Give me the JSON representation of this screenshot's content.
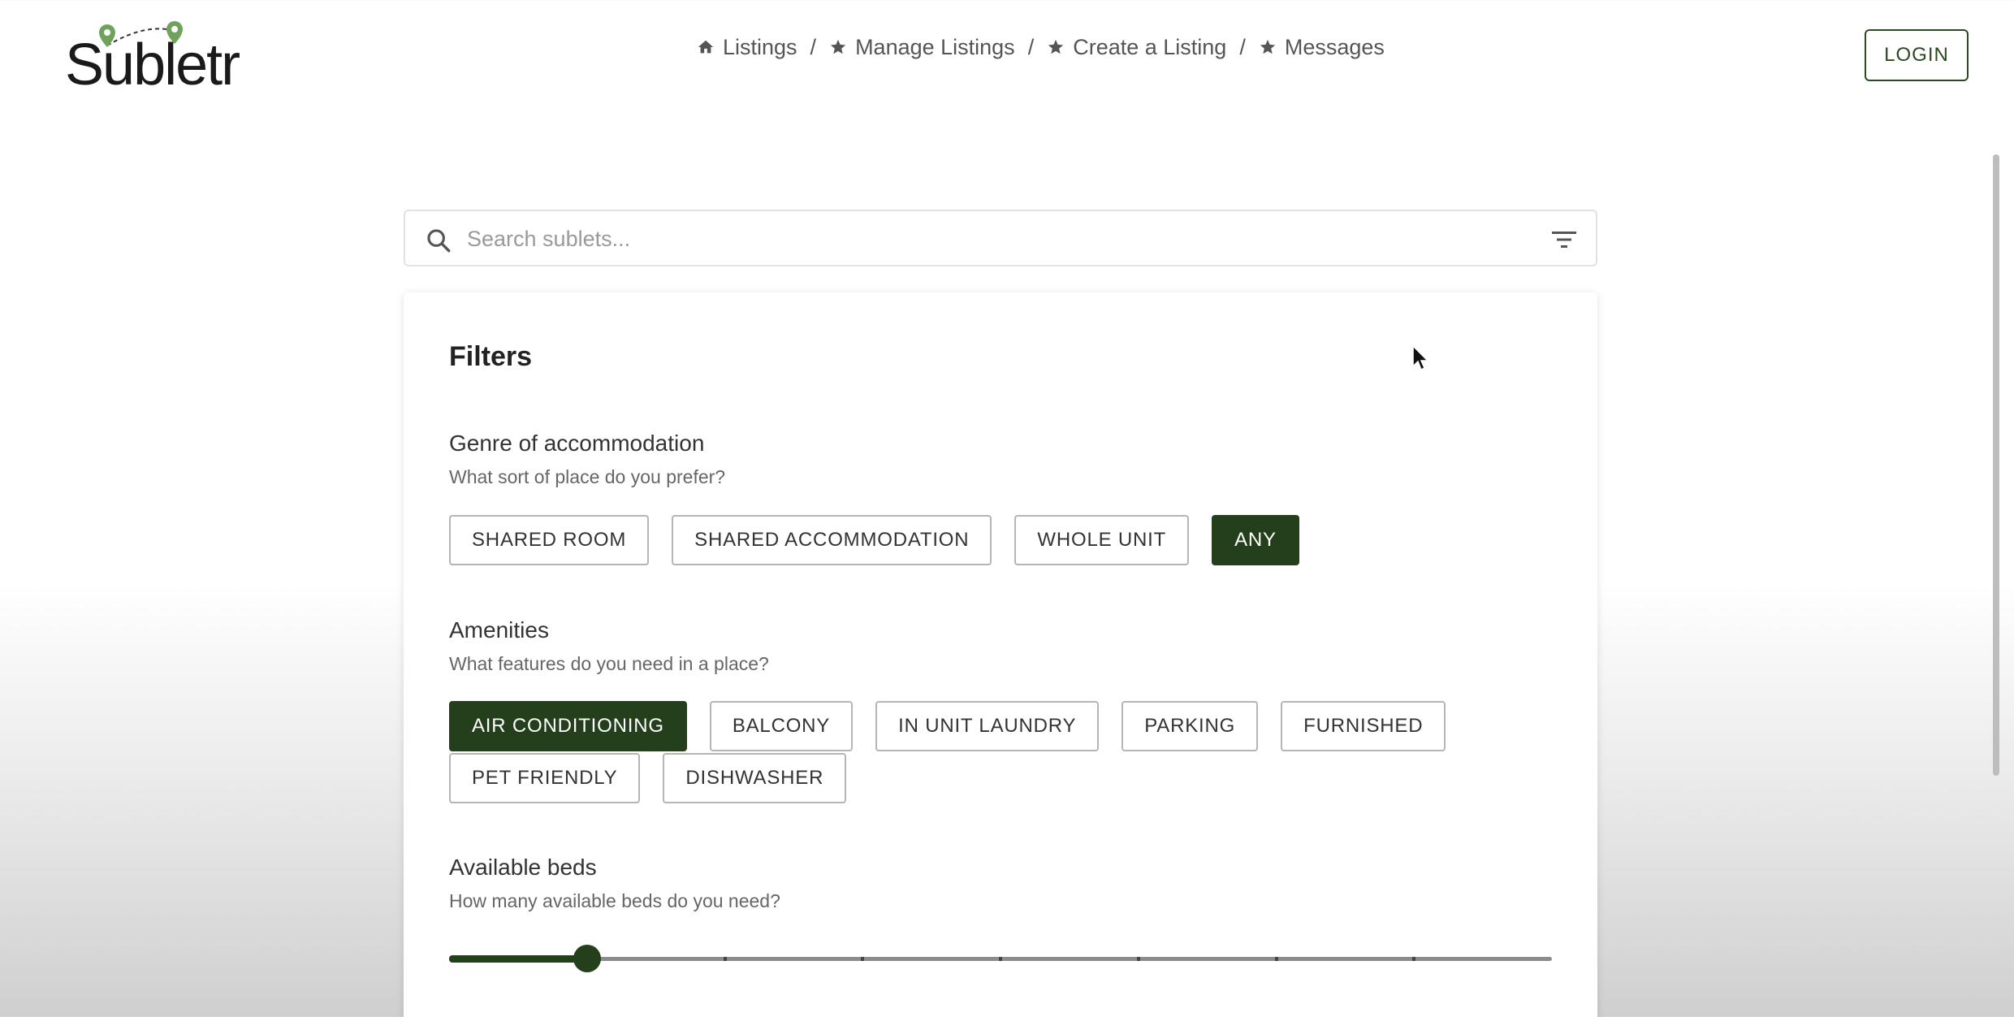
{
  "app": {
    "logo_text": "Subletr"
  },
  "nav": {
    "items": [
      {
        "label": "Listings",
        "icon": "home-icon"
      },
      {
        "label": "Manage Listings",
        "icon": "star-icon"
      },
      {
        "label": "Create a Listing",
        "icon": "star-icon"
      },
      {
        "label": "Messages",
        "icon": "star-icon"
      }
    ],
    "separator": "/"
  },
  "header": {
    "login_label": "LOGIN"
  },
  "search": {
    "placeholder": "Search sublets...",
    "value": ""
  },
  "filters": {
    "title": "Filters",
    "genre": {
      "title": "Genre of accommodation",
      "subtitle": "What sort of place do you prefer?",
      "options": [
        "SHARED ROOM",
        "SHARED ACCOMMODATION",
        "WHOLE UNIT",
        "ANY"
      ],
      "selected": "ANY"
    },
    "amenities": {
      "title": "Amenities",
      "subtitle": "What features do you need in a place?",
      "options_row1": [
        "AIR CONDITIONING",
        "BALCONY",
        "IN UNIT LAUNDRY",
        "PARKING",
        "FURNISHED"
      ],
      "options_row2": [
        "PET FRIENDLY",
        "DISHWASHER"
      ],
      "selected": [
        "AIR CONDITIONING"
      ]
    },
    "beds": {
      "title": "Available beds",
      "subtitle": "How many available beds do you need?",
      "min": 0,
      "max": 8,
      "value": 1,
      "steps": 8
    }
  },
  "colors": {
    "accent": "#243f1c",
    "logo_pin": "#6fa35c"
  }
}
